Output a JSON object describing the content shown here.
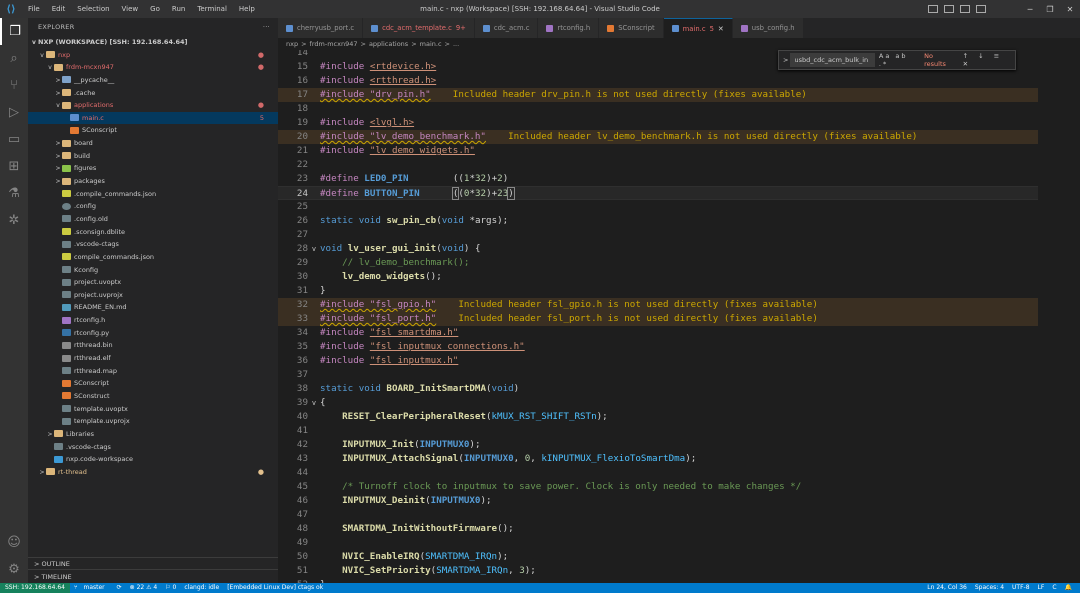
{
  "titlebar": {
    "menu": [
      "File",
      "Edit",
      "Selection",
      "View",
      "Go",
      "Run",
      "Terminal",
      "Help"
    ],
    "title": "main.c - nxp (Workspace) [SSH: 192.168.64.64] - Visual Studio Code"
  },
  "sidebar": {
    "header": "EXPLORER",
    "workspace": "NXP (WORKSPACE) [SSH: 192.168.64.64]",
    "items": [
      {
        "name": "nxp",
        "indent": 1,
        "chev": "v",
        "icon": "folder",
        "status": "dot",
        "color": "red"
      },
      {
        "name": "frdm-mcxn947",
        "indent": 2,
        "chev": "v",
        "icon": "folder",
        "status": "dot",
        "color": "red"
      },
      {
        "name": "__pycache__",
        "indent": 3,
        "chev": ">",
        "icon": "folder-blue"
      },
      {
        "name": ".cache",
        "indent": 3,
        "chev": ">",
        "icon": "folder"
      },
      {
        "name": "applications",
        "indent": 3,
        "chev": "v",
        "icon": "folder",
        "status": "dot",
        "color": "red"
      },
      {
        "name": "main.c",
        "indent": 4,
        "chev": "",
        "icon": "c",
        "status": "5",
        "color": "red",
        "active": true
      },
      {
        "name": "SConscript",
        "indent": 4,
        "chev": "",
        "icon": "sc"
      },
      {
        "name": "board",
        "indent": 3,
        "chev": ">",
        "icon": "folder"
      },
      {
        "name": "build",
        "indent": 3,
        "chev": ">",
        "icon": "folder"
      },
      {
        "name": "figures",
        "indent": 3,
        "chev": ">",
        "icon": "folder-green"
      },
      {
        "name": "packages",
        "indent": 3,
        "chev": ">",
        "icon": "folder"
      },
      {
        "name": ".compile_commands.json",
        "indent": 3,
        "chev": "",
        "icon": "json"
      },
      {
        "name": ".config",
        "indent": 3,
        "chev": "",
        "icon": "gear"
      },
      {
        "name": ".config.old",
        "indent": 3,
        "chev": "",
        "icon": "txt"
      },
      {
        "name": ".sconsign.dblite",
        "indent": 3,
        "chev": "",
        "icon": "json"
      },
      {
        "name": ".vscode-ctags",
        "indent": 3,
        "chev": "",
        "icon": "txt"
      },
      {
        "name": "compile_commands.json",
        "indent": 3,
        "chev": "",
        "icon": "json"
      },
      {
        "name": "Kconfig",
        "indent": 3,
        "chev": "",
        "icon": "txt"
      },
      {
        "name": "project.uvoptx",
        "indent": 3,
        "chev": "",
        "icon": "txt"
      },
      {
        "name": "project.uvprojx",
        "indent": 3,
        "chev": "",
        "icon": "txt"
      },
      {
        "name": "README_EN.md",
        "indent": 3,
        "chev": "",
        "icon": "md"
      },
      {
        "name": "rtconfig.h",
        "indent": 3,
        "chev": "",
        "icon": "h"
      },
      {
        "name": "rtconfig.py",
        "indent": 3,
        "chev": "",
        "icon": "py"
      },
      {
        "name": "rtthread.bin",
        "indent": 3,
        "chev": "",
        "icon": "bin"
      },
      {
        "name": "rtthread.elf",
        "indent": 3,
        "chev": "",
        "icon": "bin"
      },
      {
        "name": "rtthread.map",
        "indent": 3,
        "chev": "",
        "icon": "txt"
      },
      {
        "name": "SConscript",
        "indent": 3,
        "chev": "",
        "icon": "sc"
      },
      {
        "name": "SConstruct",
        "indent": 3,
        "chev": "",
        "icon": "sc"
      },
      {
        "name": "template.uvoptx",
        "indent": 3,
        "chev": "",
        "icon": "txt"
      },
      {
        "name": "template.uvprojx",
        "indent": 3,
        "chev": "",
        "icon": "txt"
      },
      {
        "name": "Libraries",
        "indent": 2,
        "chev": ">",
        "icon": "folder"
      },
      {
        "name": ".vscode-ctags",
        "indent": 2,
        "chev": "",
        "icon": "txt"
      },
      {
        "name": "nxp.code-workspace",
        "indent": 2,
        "chev": "",
        "icon": "code"
      },
      {
        "name": "rt-thread",
        "indent": 1,
        "chev": ">",
        "icon": "folder",
        "status": "dot",
        "color": "orange"
      }
    ],
    "outline": "OUTLINE",
    "timeline": "TIMELINE"
  },
  "tabs": [
    {
      "label": "cherryusb_port.c",
      "icon": "c"
    },
    {
      "label": "cdc_acm_template.c",
      "badge": "9+",
      "icon": "c",
      "error": true
    },
    {
      "label": "cdc_acm.c",
      "icon": "c"
    },
    {
      "label": "rtconfig.h",
      "icon": "h"
    },
    {
      "label": "SConscript",
      "icon": "sc"
    },
    {
      "label": "main.c",
      "badge": "5",
      "icon": "c",
      "active": true,
      "error": true
    },
    {
      "label": "usb_config.h",
      "icon": "h"
    }
  ],
  "breadcrumb": [
    "nxp",
    ">",
    "frdm-mcxn947",
    ">",
    "applications",
    ">",
    "main.c",
    ">",
    "..."
  ],
  "find": {
    "value": "usbd_cdc_acm_bulk_in",
    "options": "Aa ab .*",
    "result": "No results",
    "buttons": "↑ ↓ ≡ ✕"
  },
  "editor": {
    "current_line": 24,
    "warn_text_drv": "Included header drv_pin.h is not used directly (fixes available)",
    "warn_text_bench": "Included header lv_demo_benchmark.h is not used directly (fixes available)",
    "warn_text_gpio": "Included header fsl_gpio.h is not used directly (fixes available)",
    "warn_text_port": "Included header fsl_port.h is not used directly (fixes available)"
  },
  "statusbar": {
    "remote": "SSH: 192.168.64.64",
    "branch": "master",
    "problems": "⊗ 22 ⚠ 4",
    "ports": "⚐ 0",
    "clangd": "clangd: idle",
    "env": "[Embedded Linux Dev] ctags ok",
    "position": "Ln 24, Col 36",
    "spaces": "Spaces: 4",
    "encoding": "UTF-8",
    "eol": "LF",
    "lang": "C"
  }
}
